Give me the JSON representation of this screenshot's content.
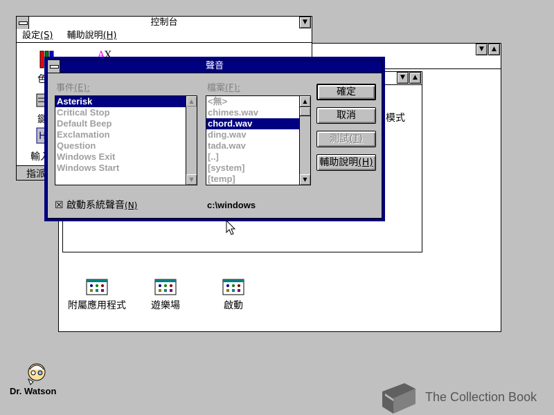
{
  "control_panel": {
    "title": "控制台",
    "menu": [
      {
        "label": "設定",
        "key": "(S)"
      },
      {
        "label": "輔助說明",
        "key": "(H)"
      }
    ],
    "partial_labels": [
      "色",
      "鍵",
      "輸入"
    ],
    "status_prefix": "指派"
  },
  "program_manager_back": {
    "partial_label": "模式"
  },
  "program_group": {
    "icons": [
      {
        "label": "附屬應用程式",
        "icon": "program-group-icon"
      },
      {
        "label": "遊樂場",
        "icon": "program-group-icon"
      },
      {
        "label": "啟動",
        "icon": "program-group-icon"
      }
    ]
  },
  "sound_dialog": {
    "title": "聲音",
    "events_label": "事件",
    "events_key": "(E):",
    "events": [
      "Asterisk",
      "Critical Stop",
      "Default Beep",
      "Exclamation",
      "Question",
      "Windows Exit",
      "Windows Start"
    ],
    "selected_event": "Asterisk",
    "files_label": "檔案",
    "files_key": "(F):",
    "files": [
      "<無>",
      "chimes.wav",
      "chord.wav",
      "ding.wav",
      "tada.wav",
      "[..]",
      "[system]",
      "[temp]"
    ],
    "selected_file": "chord.wav",
    "buttons": {
      "ok": "確定",
      "cancel": "取消",
      "test": "測試",
      "test_key": "(T)",
      "help": "輔助說明",
      "help_key": "(H)"
    },
    "checkbox_label": "啟動系統聲音",
    "checkbox_key": "(N)",
    "checkbox_checked": true,
    "checkbox_mark": "☒",
    "path": "c:\\windows"
  },
  "desktop": {
    "dr_watson_label": "Dr. Watson",
    "watermark": "The Collection Book"
  },
  "colors": {
    "desktop": "#c0c0c0",
    "active_title": "#000080",
    "selection": "#000080"
  }
}
